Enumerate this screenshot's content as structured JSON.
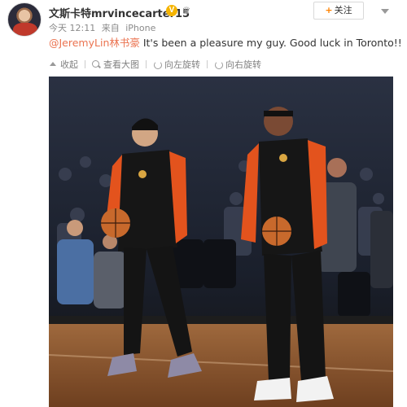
{
  "post": {
    "username": "文斯卡特mrvincecarter15",
    "badge_verified": "V",
    "meta": {
      "time": "今天 12:11",
      "source_prefix": "来自",
      "source": "iPhone"
    },
    "follow_button": {
      "label": "关注",
      "icon": "plus-icon"
    },
    "more_button": {
      "icon": "chevron-down-icon"
    },
    "text": {
      "mention": "@JeremyLin林书豪",
      "body": " It's been a pleasure my guy. Good luck in Toronto!!"
    },
    "toolbar": [
      {
        "label": "收起",
        "icon": "collapse-icon"
      },
      {
        "label": "查看大图",
        "icon": "zoom-icon"
      },
      {
        "label": "向左旋转",
        "icon": "rotate-left-icon"
      },
      {
        "label": "向右旋转",
        "icon": "rotate-right-icon"
      }
    ],
    "photo": {
      "jersey_colors": {
        "orange": "#e3531d",
        "black": "#161616"
      },
      "ball_color": "#c8692c",
      "floor_color": "#8a5630",
      "shoe_color": "#8e8aa6"
    }
  },
  "colors": {
    "accent": "#ff8200",
    "mention": "#eb7350",
    "meta": "#8a8a8a"
  }
}
